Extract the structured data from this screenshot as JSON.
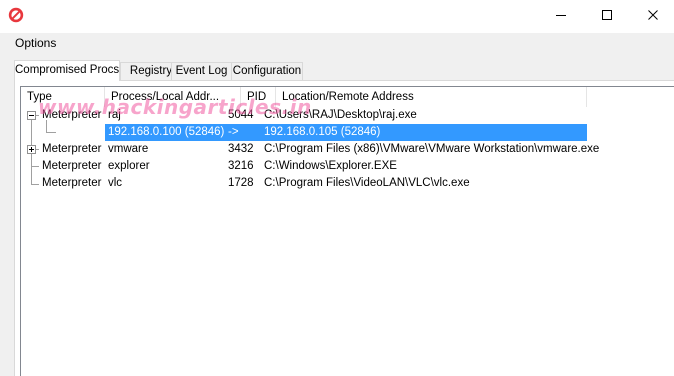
{
  "menu": {
    "options_label": "Options"
  },
  "tabs": [
    {
      "label": "Compromised Procs",
      "active": true
    },
    {
      "label": "Registry",
      "active": false
    },
    {
      "label": "Event Log",
      "active": false
    },
    {
      "label": "Configuration",
      "active": false
    }
  ],
  "columns": {
    "type": "Type",
    "process": "Process/Local Addr...",
    "pid": "PID",
    "location": "Location/Remote Address"
  },
  "rows": [
    {
      "type": "Meterpreter",
      "process": "raj",
      "pid": "5044",
      "location": "C:\\Users\\RAJ\\Desktop\\raj.exe",
      "expander": "-"
    },
    {
      "type": "",
      "process": "192.168.0.100 (52846)",
      "pid": "->",
      "location": "192.168.0.105 (52846)",
      "selected": true
    },
    {
      "type": "Meterpreter",
      "process": "vmware",
      "pid": "3432",
      "location": "C:\\Program Files (x86)\\VMware\\VMware Workstation\\vmware.exe",
      "expander": "+"
    },
    {
      "type": "Meterpreter",
      "process": "explorer",
      "pid": "3216",
      "location": "C:\\Windows\\Explorer.EXE"
    },
    {
      "type": "Meterpreter",
      "process": "vlc",
      "pid": "1728",
      "location": "C:\\Program Files\\VideoLAN\\VLC\\vlc.exe"
    }
  ],
  "watermark": "www.hackingarticles.in",
  "colors": {
    "selection": "#3399ff",
    "app_icon": "#e8373d"
  }
}
